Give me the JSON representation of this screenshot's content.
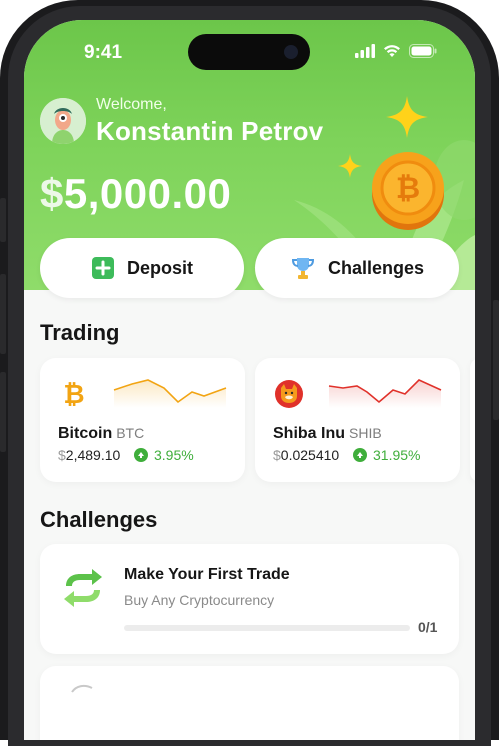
{
  "status_bar": {
    "time": "9:41"
  },
  "user": {
    "welcome": "Welcome,",
    "name": "Konstantin Petrov"
  },
  "balance": {
    "dollar_sign": "$",
    "amount": "5,000.00"
  },
  "actions": {
    "deposit_label": "Deposit",
    "challenges_label": "Challenges"
  },
  "trading": {
    "title": "Trading",
    "coins": [
      {
        "name": "Bitcoin",
        "symbol": "BTC",
        "currency": "$",
        "price": "2,489.10",
        "change": "3.95%",
        "icon": "bitcoin-icon",
        "color": "#f2a413"
      },
      {
        "name": "Shiba Inu",
        "symbol": "SHIB",
        "currency": "$",
        "price": "0.025410",
        "change": "31.95%",
        "icon": "shiba-inu-icon",
        "color": "#e0312a"
      }
    ]
  },
  "challenges": {
    "title": "Challenges",
    "items": [
      {
        "title": "Make Your First Trade",
        "subtitle": "Buy Any Cryptocurrency",
        "progress_text": "0/1",
        "progress": 0
      }
    ]
  },
  "colors": {
    "brand_green": "#6cc64a",
    "positive": "#3fae3b",
    "bitcoin_orange": "#f2a413",
    "shib_red": "#e0312a"
  }
}
